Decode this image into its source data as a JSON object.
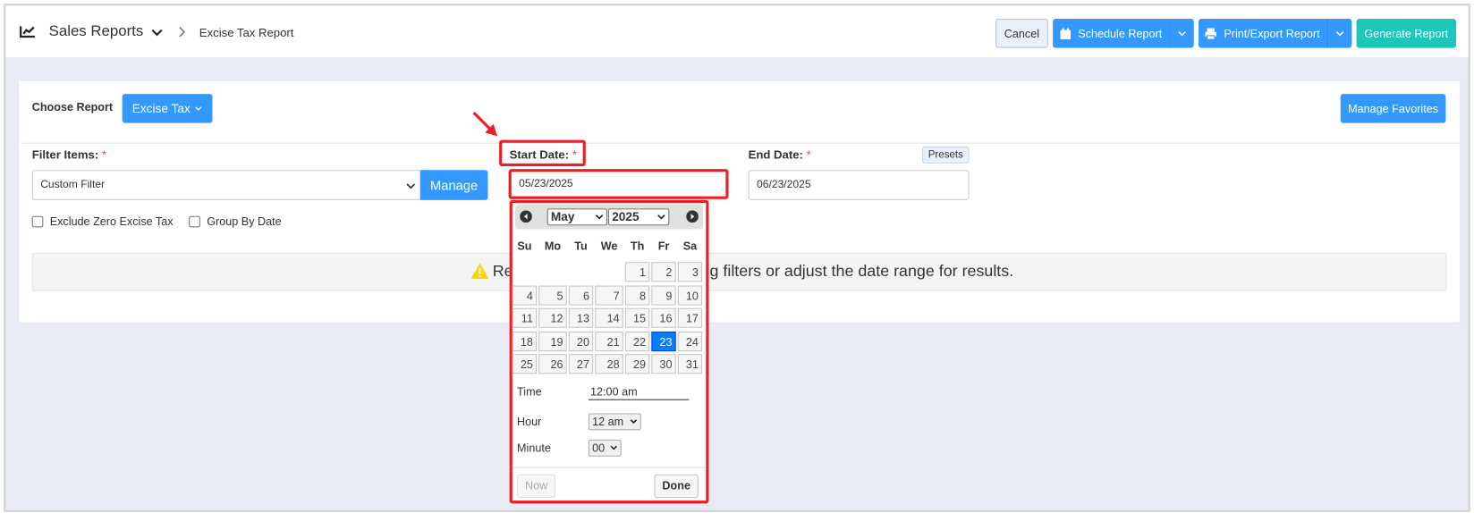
{
  "header": {
    "section": "Sales Reports",
    "breadcrumb": "Excise Tax Report",
    "cancel": "Cancel",
    "schedule": "Schedule Report",
    "print": "Print/Export Report",
    "generate": "Generate Report"
  },
  "report": {
    "choose_label": "Choose Report",
    "selected": "Excise Tax",
    "manage_favorites": "Manage Favorites"
  },
  "filters": {
    "items_label": "Filter Items:",
    "required": "*",
    "items_value": "Custom Filter",
    "manage": "Manage",
    "exclude_zero": "Exclude Zero Excise Tax",
    "group_by_date": "Group By Date"
  },
  "dates": {
    "start_label": "Start Date:",
    "start_value": "05/23/2025",
    "end_label": "End Date:",
    "end_value": "06/23/2025",
    "presets": "Presets"
  },
  "message": {
    "part1": "Re",
    "part2": "g filters or adjust the date range for results."
  },
  "calendar": {
    "month": "May",
    "year": "2025",
    "weekdays": [
      "Su",
      "Mo",
      "Tu",
      "We",
      "Th",
      "Fr",
      "Sa"
    ],
    "first_weekday": 4,
    "days": 31,
    "selected_day": 23,
    "time_label": "Time",
    "time_value": "12:00 am",
    "hour_label": "Hour",
    "hour_value": "12 am",
    "minute_label": "Minute",
    "minute_value": "00",
    "now": "Now",
    "done": "Done"
  },
  "colors": {
    "primary": "#3399ff",
    "generate": "#1cc6b8",
    "highlight": "#ee1c25",
    "selected_day": "#007fff"
  }
}
